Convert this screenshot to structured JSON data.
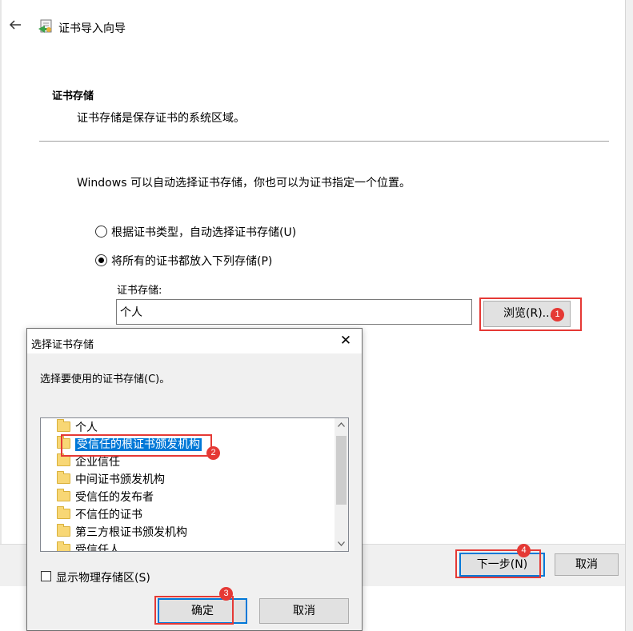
{
  "wizard": {
    "title": "证书导入向导",
    "section_title": "证书存储",
    "section_subtitle": "证书存储是保存证书的系统区域。",
    "intro": "Windows 可以自动选择证书存储，你也可以为证书指定一个位置。",
    "options": [
      {
        "label": "根据证书类型，自动选择证书存储(U)",
        "checked": false
      },
      {
        "label": "将所有的证书都放入下列存储(P)",
        "checked": true
      }
    ],
    "store_label": "证书存储:",
    "store_value": "个人",
    "browse_label": "浏览(R)...",
    "next_label": "下一步(N)",
    "cancel_label": "取消"
  },
  "dialog": {
    "title": "选择证书存储",
    "close_glyph": "✕",
    "prompt": "选择要使用的证书存储(C)。",
    "items": [
      {
        "label": "个人",
        "selected": false
      },
      {
        "label": "受信任的根证书颁发机构",
        "selected": true
      },
      {
        "label": "企业信任",
        "selected": false
      },
      {
        "label": "中间证书颁发机构",
        "selected": false
      },
      {
        "label": "受信任的发布者",
        "selected": false
      },
      {
        "label": "不信任的证书",
        "selected": false
      },
      {
        "label": "第三方根证书颁发机构",
        "selected": false
      },
      {
        "label": "受信任人",
        "selected": false
      }
    ],
    "show_physical_label": "显示物理存储区(S)",
    "show_physical_checked": false,
    "ok_label": "确定",
    "cancel_label": "取消"
  },
  "annotations": {
    "badge1": "1",
    "badge2": "2",
    "badge3": "3",
    "badge4": "4",
    "color": "#e53935"
  },
  "colors": {
    "selection": "#0078d7",
    "focus_border": "#0078d7"
  }
}
